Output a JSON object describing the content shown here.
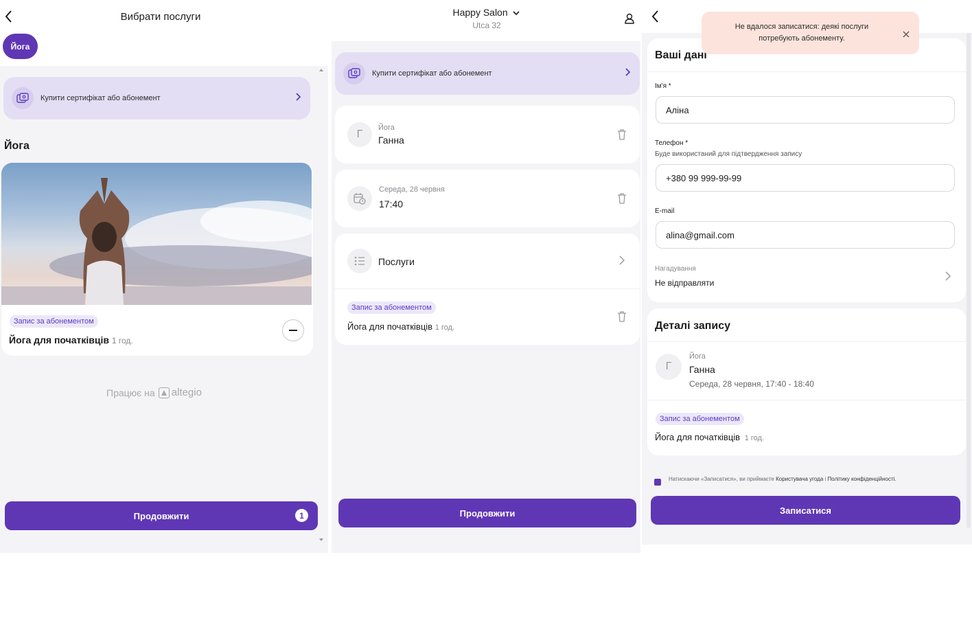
{
  "left": {
    "header_title": "Вибрати послуги",
    "chip_label": "Йога",
    "promo_text": "Купити сертифікат або абонемент",
    "section_title": "Йога",
    "service": {
      "badge": "Запис за абонементом",
      "name": "Йога для початківців",
      "duration": "1 год."
    },
    "powered_prefix": "Працює на",
    "powered_brand": "altegio",
    "continue_label": "Продовжити",
    "cart_count": "1"
  },
  "middle": {
    "salon_name": "Happy Salon",
    "salon_address": "Utca 32",
    "promo_text": "Купити сертифікат або абонемент",
    "staff": {
      "initial": "Г",
      "category": "Йога",
      "name": "Ганна"
    },
    "datetime": {
      "date": "Середа, 28 червня",
      "time": "17:40"
    },
    "services_label": "Послуги",
    "service": {
      "badge": "Запис за абонементом",
      "name": "Йога для початківців",
      "duration": "1 год."
    },
    "continue_label": "Продовжити"
  },
  "right": {
    "toast_text": "Не вдалося записатися: деякі послуги потребують абонементу.",
    "your_data_title": "Ваші дані",
    "name_label": "Ім'я *",
    "name_value": "Аліна",
    "phone_label": "Телефон *",
    "phone_hint": "Буде використаний для підтвердження запису",
    "phone_value": "+380 99 999-99-99",
    "email_label": "E-mail",
    "email_value": "alina@gmail.com",
    "reminder_label": "Нагадування",
    "reminder_value": "Не відправляти",
    "details_title": "Деталі запису",
    "staff_initial": "Г",
    "staff_category": "Йога",
    "staff_name": "Ганна",
    "staff_datetime": "Середа, 28 червня, 17:40 - 18:40",
    "service_badge": "Запис за абонементом",
    "service_name": "Йога для початківців",
    "service_duration": "1 год.",
    "consent_prefix": "Натискаючи «Записатися», ви приймаєте",
    "consent_link1": "Користувача угода",
    "consent_and": "і",
    "consent_link2": "Політику конфіденційності.",
    "submit_label": "Записатися"
  },
  "colors": {
    "accent": "#5f37b5",
    "promo_bg": "#e4def4",
    "badge_bg": "#ece7f8",
    "toast_bg": "#fce3dc"
  }
}
